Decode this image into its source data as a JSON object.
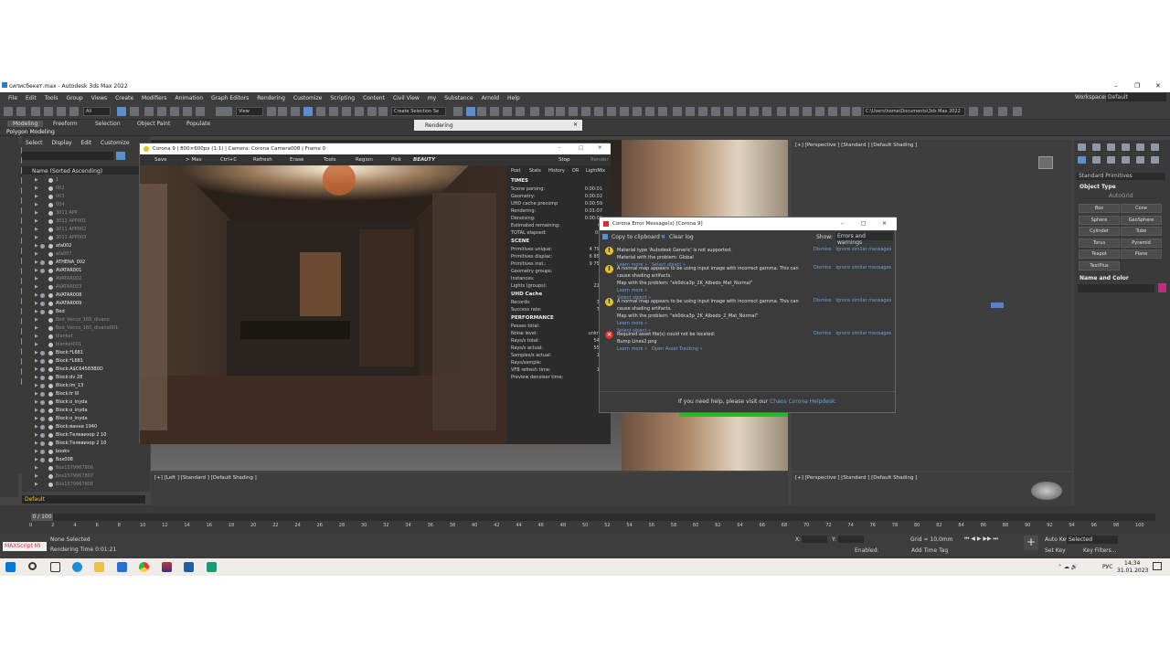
{
  "window": {
    "title": "сиписбекет.max - Autodesk 3ds Max 2022",
    "workspaces_label": "Workspaces:",
    "workspaces_value": "Default"
  },
  "menu": [
    "File",
    "Edit",
    "Tools",
    "Group",
    "Views",
    "Create",
    "Modifiers",
    "Animation",
    "Graph Editors",
    "Rendering",
    "Customize",
    "Scripting",
    "Content",
    "Civil View",
    "my",
    "Substance",
    "Arnold",
    "Help"
  ],
  "toolbar": {
    "filter_value": "All",
    "view_value": "View",
    "selection_set": "Create Selection Se",
    "path": "C:\\Users\\home\\Documents\\3ds Max 2022"
  },
  "ribbon": {
    "tabs": [
      "Modeling",
      "Freeform",
      "Selection",
      "Object Paint",
      "Populate"
    ],
    "sub": "Polygon Modeling"
  },
  "rendering_panel": {
    "title": "Rendering"
  },
  "explorer": {
    "tabs": [
      "Select",
      "Display",
      "Edit",
      "Customize"
    ],
    "header": "Name (Sorted Ascending)",
    "rows": [
      {
        "name": "1",
        "dim": true
      },
      {
        "name": "002",
        "dim": true
      },
      {
        "name": "003",
        "dim": true
      },
      {
        "name": "004",
        "dim": true
      },
      {
        "name": "3011 APP",
        "dim": true
      },
      {
        "name": "3011 APP001",
        "dim": true
      },
      {
        "name": "3011 APP002",
        "dim": true
      },
      {
        "name": "3011 APP003",
        "dim": true
      },
      {
        "name": "afa002",
        "dim": false
      },
      {
        "name": "afa007",
        "dim": true
      },
      {
        "name": "ATHENA_002",
        "dim": false
      },
      {
        "name": "AVATAR001",
        "dim": false
      },
      {
        "name": "AVATAR002",
        "dim": true
      },
      {
        "name": "AVATAR003",
        "dim": true
      },
      {
        "name": "AVATAR008",
        "dim": false
      },
      {
        "name": "AVATAR009",
        "dim": false
      },
      {
        "name": "Bed",
        "dim": false
      },
      {
        "name": "Bed_Venco_160_divano",
        "dim": true
      },
      {
        "name": "Bed_Venco_160_divano001",
        "dim": true
      },
      {
        "name": "blanket",
        "dim": true
      },
      {
        "name": "blanket001",
        "dim": true
      },
      {
        "name": "Block:*L681",
        "dim": false
      },
      {
        "name": "Block:*L681",
        "dim": false
      },
      {
        "name": "Block:A$C64583B0D",
        "dim": false
      },
      {
        "name": "Block:dv 28",
        "dim": false
      },
      {
        "name": "Block:im_13",
        "dim": false
      },
      {
        "name": "Block:tr III",
        "dim": false
      },
      {
        "name": "Block:o_inyda",
        "dim": false
      },
      {
        "name": "Block:o_inyda",
        "dim": false
      },
      {
        "name": "Block:o_inyda",
        "dim": false
      },
      {
        "name": "Block:ванна 1940",
        "dim": false
      },
      {
        "name": "Block:Телевизор 2 10",
        "dim": false
      },
      {
        "name": "Block:Телевизор 2 10",
        "dim": false
      },
      {
        "name": "books",
        "dim": false
      },
      {
        "name": "Box008",
        "dim": false
      },
      {
        "name": "Box1579967806",
        "dim": true
      },
      {
        "name": "Box1579967807",
        "dim": true
      },
      {
        "name": "Box1579967808",
        "dim": true
      }
    ],
    "layer": "Default"
  },
  "viewports": {
    "top_right": "[+] [Perspective ] [Standard ] [Default Shading ]",
    "bottom_left": "[+] [Left ] [Standard ] [Default Shading ]",
    "bottom_right": "[+] [Perspective ] [Standard ] [Default Shading ]"
  },
  "command_panel": {
    "dropdown": "Standard Primitives",
    "object_type": "Object Type",
    "autogrid": "AutoGrid",
    "buttons": [
      "Box",
      "Cone",
      "Sphere",
      "GeoSphere",
      "Cylinder",
      "Tube",
      "Torus",
      "Pyramid",
      "Teapot",
      "Plane",
      "TextPlus"
    ],
    "name_color": "Name and Color"
  },
  "corona": {
    "title": "Corona 9 | 800×600px (1:1) | Camera: Corona Camera008 | Frame 0",
    "tools": [
      "Save",
      "> Max",
      "Ctrl+C",
      "Refresh",
      "Erase",
      "Tools",
      "Region",
      "Pick",
      "BEAUTY",
      "Stop",
      "Render"
    ],
    "tabs": [
      "Post",
      "Stats",
      "History",
      "DR",
      "LightMix"
    ],
    "sections": {
      "times": "TIMES",
      "scene": "SCENE",
      "uhd": "UHD Cache",
      "perf": "PERFORMANCE"
    },
    "times": [
      {
        "k": "Scene parsing:",
        "v": "0:00:01"
      },
      {
        "k": "Geometry:",
        "v": "0:00:02"
      },
      {
        "k": "UHD cache precomp",
        "v": "0:00:59"
      },
      {
        "k": "Rendering:",
        "v": "0:01:07"
      },
      {
        "k": "Denoising:",
        "v": "0:00:00"
      },
      {
        "k": "Estimated remaining:",
        "v": "0:"
      },
      {
        "k": "TOTAL elapsed:",
        "v": "0:0"
      }
    ],
    "scene": [
      {
        "k": "Primitives unique:",
        "v": "4 793"
      },
      {
        "k": "Primitives displac:",
        "v": "6 858"
      },
      {
        "k": "Primitives inst.:",
        "v": "9 750"
      },
      {
        "k": "Geometry groups:",
        "v": ""
      },
      {
        "k": "Instances:",
        "v": ""
      },
      {
        "k": "Lights (groups):",
        "v": "216"
      }
    ],
    "uhd": [
      {
        "k": "Records:",
        "v": "35"
      },
      {
        "k": "Success rate:",
        "v": "75"
      }
    ],
    "perf": [
      {
        "k": "Passes total:",
        "v": ""
      },
      {
        "k": "Noise level:",
        "v": "unkno"
      },
      {
        "k": "Rays/s total:",
        "v": "542"
      },
      {
        "k": "Rays/s actual:",
        "v": "558"
      },
      {
        "k": "Samples/s actual:",
        "v": "11"
      },
      {
        "k": "Rays/sample:",
        "v": ""
      },
      {
        "k": "VFB refresh time:",
        "v": "13"
      },
      {
        "k": "Preview denoiser time:",
        "v": ""
      }
    ]
  },
  "errors": {
    "title": "Corona Error Message(s)   [Corona 9]",
    "copy": "Copy to clipboard",
    "clear": "Clear log",
    "show_label": "Show:",
    "show_value": "Errors and warnings",
    "dismiss": "Dismiss",
    "ignore": "Ignore similar messages",
    "messages": [
      {
        "type": "warn",
        "text": "Material type 'Autodesk Generic' is not supported.\nMaterial with the problem: Global",
        "links": "Learn more »   Select object »"
      },
      {
        "type": "warn",
        "text": "A normal map appears to be using input image with incorrect gamma. This can cause shading artifacts.\nMap with the problem: \"ek0dca3p_2K_Albedo_Mat_Normal\"",
        "links": "Learn more »\nSelect object »"
      },
      {
        "type": "warn",
        "text": "A normal map appears to be using input image with incorrect gamma. This can cause shading artifacts.\nMap with the problem: \"ek0dca3p_2K_Albedo_2_Mat_Normal\"",
        "links": "Learn more »\nSelect object »"
      },
      {
        "type": "err",
        "text": "Required asset file(s) could not be located:\nBump Lines2.png",
        "links": "Learn more »   Open Asset Tracking »"
      }
    ],
    "footer_pre": "If you need help, please visit our",
    "footer_link": "Chaos Corona Helpdesk."
  },
  "timeline": {
    "frame": "0 / 100",
    "ticks": [
      "0",
      "2",
      "4",
      "6",
      "8",
      "10",
      "12",
      "14",
      "16",
      "18",
      "20",
      "22",
      "24",
      "26",
      "28",
      "30",
      "32",
      "34",
      "36",
      "38",
      "40",
      "42",
      "44",
      "46",
      "48",
      "50",
      "52",
      "54",
      "56",
      "58",
      "60",
      "62",
      "64",
      "66",
      "68",
      "70",
      "72",
      "74",
      "76",
      "78",
      "80",
      "82",
      "84",
      "86",
      "88",
      "90",
      "92",
      "94",
      "96",
      "98",
      "100"
    ]
  },
  "status": {
    "script": "MAXScript Mi",
    "none_selected": "None Selected",
    "render_time": "Rendering Time  0:01:21",
    "x_label": "X:",
    "y_label": "Y:",
    "grid": "Grid = 10,0mm",
    "enabled": "Enabled:",
    "add_time_tag": "Add Time Tag",
    "auto_key": "Auto Key",
    "set_key": "Set Key",
    "selected": "Selected",
    "key_filters": "Key Filters..."
  },
  "taskbar": {
    "time": "14:34",
    "date": "31.01.2023",
    "lang": "РУС"
  }
}
